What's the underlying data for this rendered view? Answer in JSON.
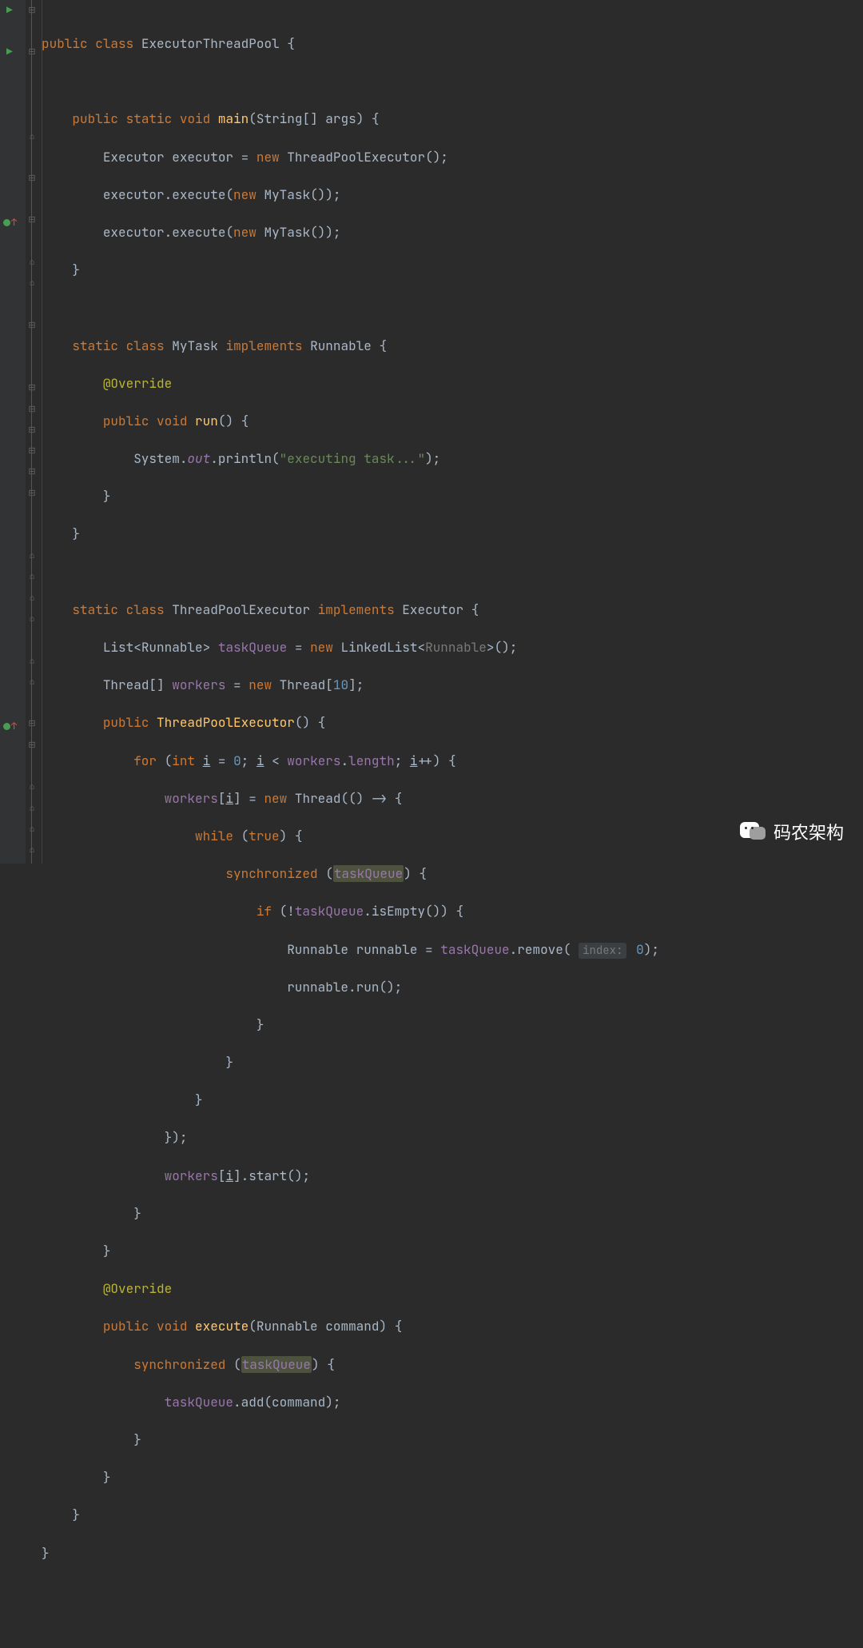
{
  "watermark": "码农架构",
  "tokens": {
    "kw_public": "public",
    "kw_class": "class",
    "kw_static": "static",
    "kw_void": "void",
    "kw_new": "new",
    "kw_implements": "implements",
    "kw_for": "for",
    "kw_int": "int",
    "kw_while": "while",
    "kw_true": "true",
    "kw_synchronized": "synchronized",
    "kw_if": "if",
    "kw_this_length": ".length",
    "cls_ExecutorThreadPool": "ExecutorThreadPool",
    "m_main": "main",
    "t_String": "String[]",
    "p_args": "args",
    "t_Executor": "Executor",
    "v_executor": "executor",
    "t_ThreadPoolExecutor": "ThreadPoolExecutor",
    "m_execute": "execute",
    "t_MyTask": "MyTask",
    "t_Runnable": "Runnable",
    "ann_Override": "@Override",
    "m_run": "run",
    "cls_System": "System",
    "f_out": "out",
    "m_println": "println",
    "str_executing": "\"executing task...\"",
    "t_List": "List",
    "t_LinkedList": "LinkedList",
    "f_taskQueue": "taskQueue",
    "t_Thread": "Thread",
    "f_workers": "workers",
    "n_10": "10",
    "v_i": "i",
    "n_0": "0",
    "op_lt": "<",
    "m_length": "length",
    "op_pp": "++",
    "m_isEmpty": "isEmpty",
    "m_remove": "remove",
    "v_runnable": "runnable",
    "hint_index": "index:",
    "n_0b": "0",
    "m_start": "start",
    "t_RunnableP": "Runnable",
    "p_command": "command",
    "m_add": "add",
    "brace_o": "{",
    "brace_c": "}",
    "paren_o": "(",
    "paren_c": ")",
    "semi": ";",
    "comma": ",",
    "assign": " = ",
    "dot": ".",
    "arrow": "->",
    "bang": "!",
    "brkt_o": "[",
    "brkt_c": "]"
  },
  "chart_data": null
}
